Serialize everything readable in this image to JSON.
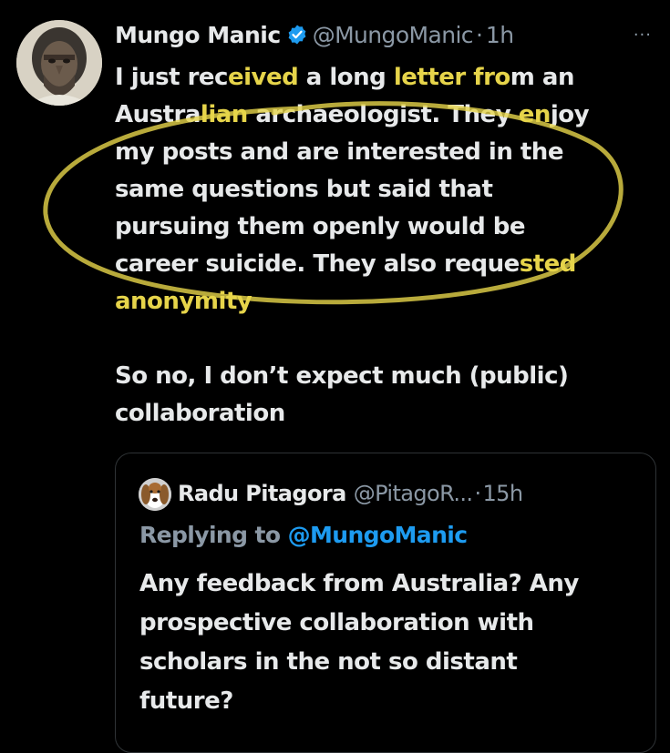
{
  "tweet": {
    "author": {
      "name": "Mungo Manic",
      "handle": "@MungoManic",
      "separator": "·",
      "time": "1h",
      "verified": true,
      "avatar_icon": "neanderthal-portrait-avatar"
    },
    "more_label": "···",
    "lines": [
      [
        "I just rec",
        "eived",
        " a long ",
        "letter",
        " ",
        "fro",
        "m an"
      ],
      [
        "Austra",
        "lian",
        " archaeologist. They ",
        "en",
        "joy"
      ],
      [
        "my posts and are interested in the"
      ],
      [
        "same questions but said that"
      ],
      [
        "pursuing them openly would be"
      ],
      [
        "career suicide. They also reque",
        "sted"
      ],
      [
        "anonymity"
      ]
    ],
    "paragraph2": [
      "So no, I don’t expect much (public)",
      "collaboration"
    ]
  },
  "quoted_tweet": {
    "author_name": "Radu Pitagora",
    "author_handle": "@PitagoR...",
    "separator": "·",
    "time": "15h",
    "avatar_icon": "beagle-dog-avatar",
    "replying_label": "Replying to",
    "replying_handle": "@MungoManic",
    "lines": [
      "Any feedback from Australia? Any",
      "prospective collaboration with",
      "scholars in the not so distant",
      "future?"
    ]
  },
  "colors": {
    "background": "#000000",
    "text": "#e7e9ea",
    "muted": "#8b98a5",
    "link": "#1d9bf0",
    "highlight_annotation": "#e6d44a",
    "border": "#2f3336"
  }
}
